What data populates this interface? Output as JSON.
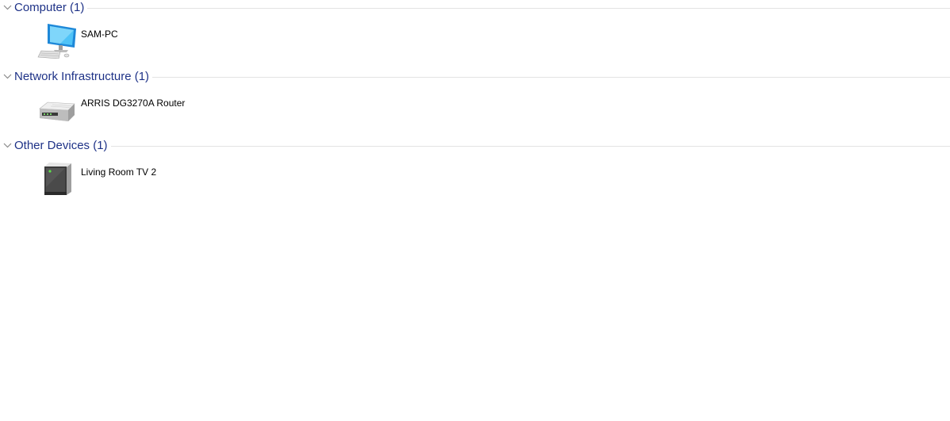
{
  "groups": [
    {
      "title": "Computer (1)",
      "items": [
        {
          "label": "SAM-PC",
          "icon": "desktop-computer-icon"
        }
      ]
    },
    {
      "title": "Network Infrastructure (1)",
      "items": [
        {
          "label": "ARRIS DG3270A Router",
          "icon": "router-icon"
        }
      ]
    },
    {
      "title": "Other Devices (1)",
      "items": [
        {
          "label": "Living Room TV 2",
          "icon": "media-device-icon"
        }
      ]
    }
  ],
  "colors": {
    "group_title": "#1e3287",
    "separator": "#e3e3e3"
  }
}
